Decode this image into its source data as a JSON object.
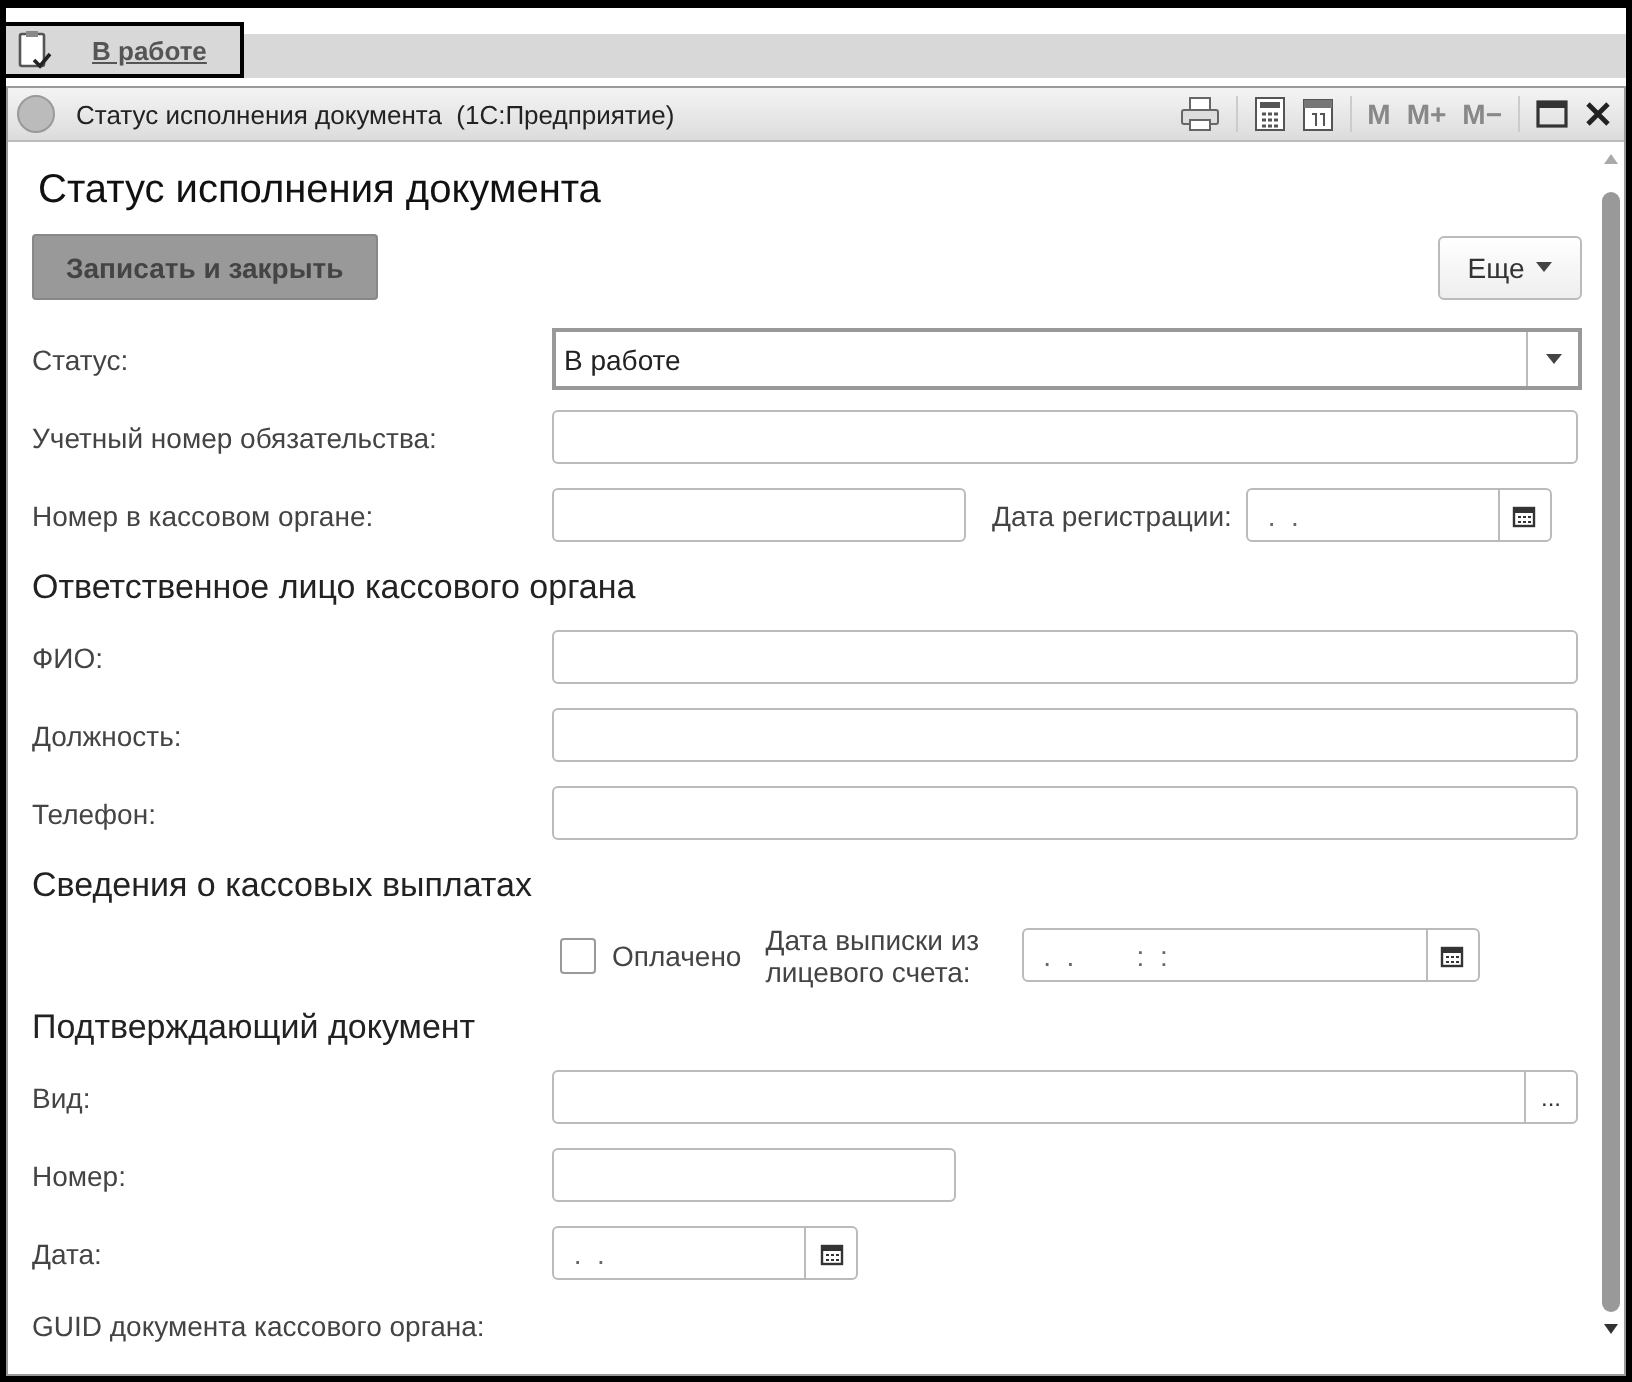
{
  "tab": {
    "label": "В работе"
  },
  "window": {
    "title": "Статус исполнения документа  (1С:Предприятие)",
    "memory_buttons": [
      "M",
      "M+",
      "M−"
    ]
  },
  "form": {
    "title": "Статус исполнения документа",
    "save_button": "Записать и закрыть",
    "more_button": "Еще"
  },
  "rows": [
    {
      "kind": "dropdown",
      "label": "Статус:",
      "value": "В работе"
    },
    {
      "kind": "text",
      "label": "Учетный номер обязательства:"
    },
    {
      "kind": "text_date",
      "label": "Номер в кассовом органе:",
      "date_label": "Дата регистрации:",
      "date_value": " .  ."
    },
    {
      "kind": "heading",
      "label": "Ответственное лицо кассового органа"
    },
    {
      "kind": "text",
      "label": "ФИО:"
    },
    {
      "kind": "text",
      "label": "Должность:"
    },
    {
      "kind": "text",
      "label": "Телефон:"
    },
    {
      "kind": "heading",
      "label": "Сведения о кассовых выплатах"
    },
    {
      "kind": "checkbox_date",
      "check_label": "Оплачено",
      "checked": false,
      "date_label": "Дата выписки из лицевого счета:",
      "date_value": " .  .        :  :"
    },
    {
      "kind": "heading",
      "label": "Подтверждающий документ"
    },
    {
      "kind": "select",
      "label": "Вид:",
      "button": "..."
    },
    {
      "kind": "short",
      "label": "Номер:"
    },
    {
      "kind": "date",
      "label": "Дата:",
      "date_value": " .  ."
    },
    {
      "kind": "label",
      "label": "GUID документа кассового органа:"
    }
  ]
}
